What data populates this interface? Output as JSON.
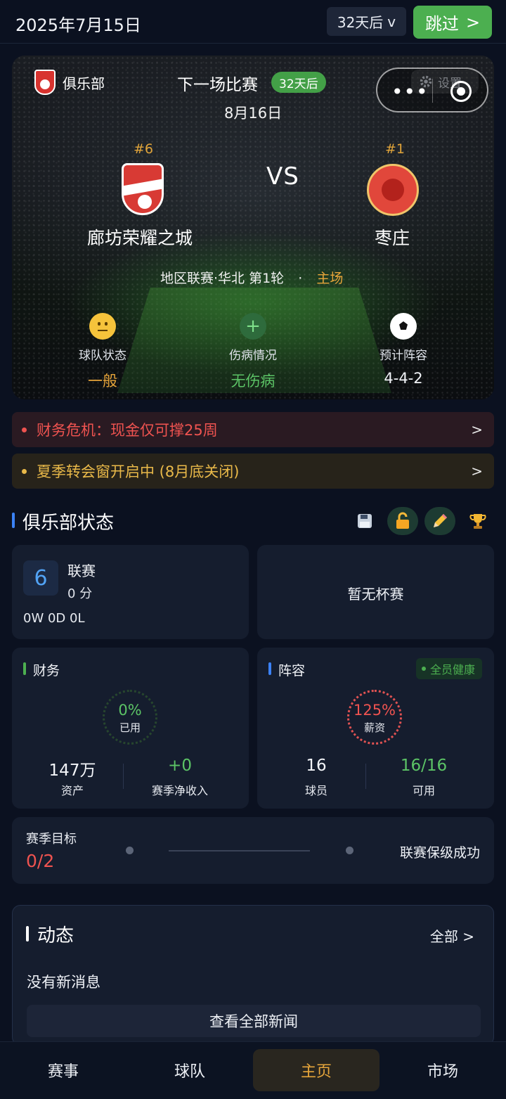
{
  "topbar": {
    "date": "2025年7月15日",
    "days_button": "32天后",
    "days_chevron": "v",
    "skip_label": "跳过",
    "skip_chevron": ">"
  },
  "hero": {
    "club_label": "俱乐部",
    "next_match_title": "下一场比赛",
    "countdown_badge": "32天后",
    "match_date": "8月16日",
    "settings_label": "设置",
    "vs": "VS",
    "home": {
      "rank": "#6",
      "name": "廊坊荣耀之城"
    },
    "away": {
      "rank": "#1",
      "name": "枣庄"
    },
    "competition": "地区联赛·华北 第1轮",
    "separator": "·",
    "venue": "主场",
    "stats": [
      {
        "label": "球队状态",
        "value": "一般",
        "color": "#e8a53a",
        "icon": "neutral-face-icon"
      },
      {
        "label": "伤病情况",
        "value": "无伤病",
        "color": "#5cc466",
        "icon": "plus-icon"
      },
      {
        "label": "预计阵容",
        "value": "4-4-2",
        "color": "#f2f4f8",
        "icon": "soccer-ball-icon"
      }
    ]
  },
  "alerts": [
    {
      "text": "财务危机：现金仅可撑25周",
      "chevron": ">"
    },
    {
      "text": "夏季转会窗开启中 (8月底关闭)",
      "chevron": ">"
    }
  ],
  "club_status": {
    "title": "俱乐部状态",
    "league": {
      "rank": "6",
      "label": "联赛",
      "points": "0 分",
      "record": "0W 0D 0L"
    },
    "cup": {
      "text": "暂无杯赛"
    },
    "finance": {
      "title": "财务",
      "ring_value": "0%",
      "ring_label": "已用",
      "assets_value": "147万",
      "assets_label": "资产",
      "income_value": "+0",
      "income_label": "赛季净收入"
    },
    "squad": {
      "title": "阵容",
      "health_badge": "全员健康",
      "ring_value": "125%",
      "ring_label": "薪资",
      "players_value": "16",
      "players_label": "球员",
      "available_value": "16/16",
      "available_label": "可用"
    },
    "season_goal": {
      "label": "赛季目标",
      "value": "0/2",
      "goal_text": "联赛保级成功"
    }
  },
  "news": {
    "title": "动态",
    "all_label": "全部 >",
    "empty_text": "没有新消息",
    "view_all_button": "查看全部新闻"
  },
  "nav": [
    "赛事",
    "球队",
    "主页",
    "市场"
  ],
  "colors": {
    "accent_green": "#4caf50",
    "alert_red": "#ef5350",
    "alert_yellow": "#e9b949",
    "active_tab": "#e7a63b",
    "blue": "#3b82f6"
  }
}
